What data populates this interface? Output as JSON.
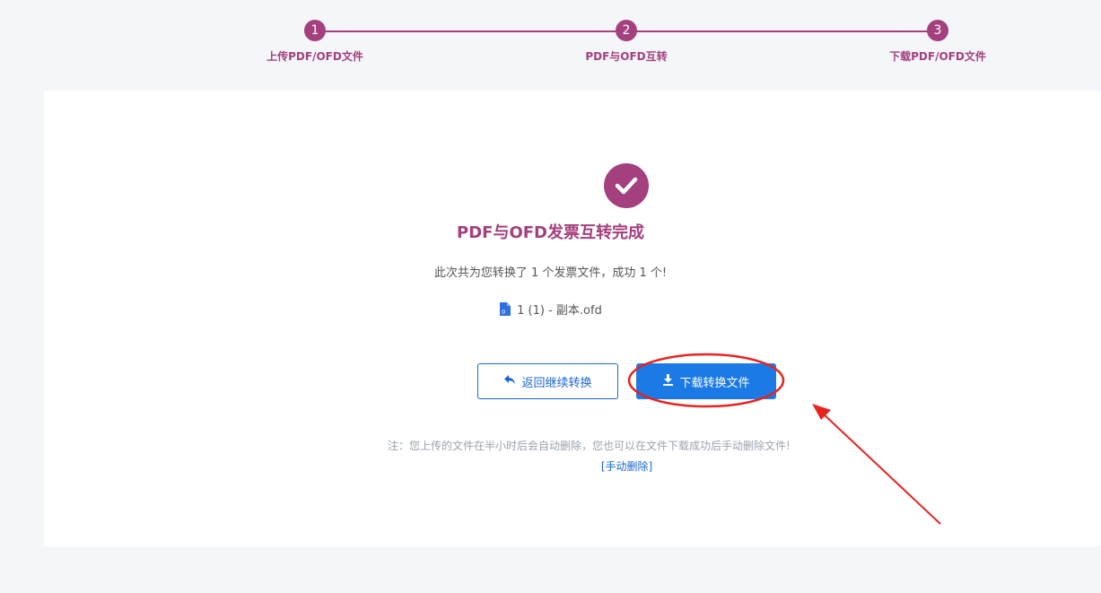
{
  "steps": [
    {
      "number": "1",
      "label": "上传PDF/OFD文件"
    },
    {
      "number": "2",
      "label": "PDF与OFD互转"
    },
    {
      "number": "3",
      "label": "下载PDF/OFD文件"
    }
  ],
  "result": {
    "title": "PDF与OFD发票互转完成",
    "summary": "此次共为您转换了 1 个发票文件，成功 1 个!",
    "file_name": "1 (1) - 副本.ofd"
  },
  "buttons": {
    "back_label": "返回继续转换",
    "download_label": "下载转换文件"
  },
  "note": {
    "text": "注：您上传的文件在半小时后会自动删除，您也可以在文件下载成功后手动删除文件!",
    "delete_link": "[手动删除]"
  },
  "colors": {
    "accent": "#a3407d",
    "primary": "#1c7ae6",
    "annotation": "#e8231f"
  },
  "icons": {
    "success": "check-circle-icon",
    "file": "ofd-file-icon",
    "back": "reply-arrow-icon",
    "download": "download-icon"
  }
}
